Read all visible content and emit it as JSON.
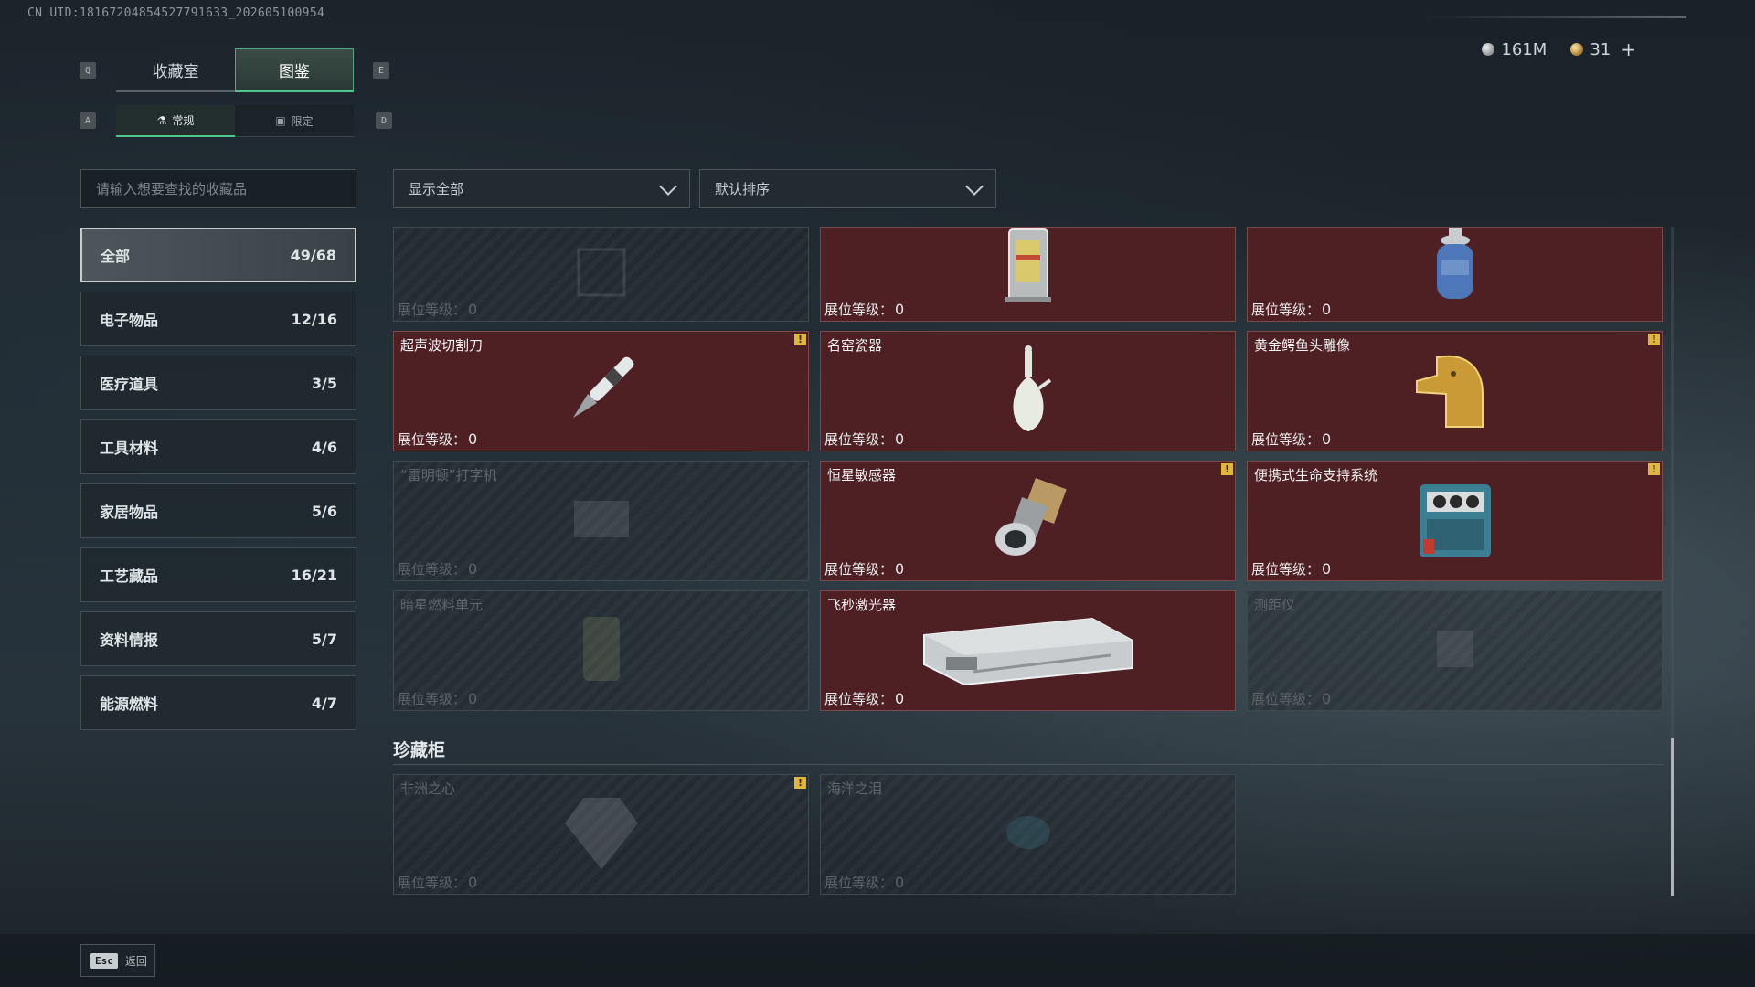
{
  "uid": "CN UID:18167204854527791633_202605100954",
  "currency": {
    "silver": "161M",
    "gold": "31",
    "plus": "+"
  },
  "keys": {
    "prev_tab": "Q",
    "next_tab": "E",
    "prev_sub": "A",
    "next_sub": "D"
  },
  "main_tabs": [
    {
      "label": "收藏室",
      "active": false
    },
    {
      "label": "图鉴",
      "active": true
    }
  ],
  "sub_tabs": [
    {
      "label": "常规",
      "icon": "flask-icon",
      "active": true
    },
    {
      "label": "限定",
      "icon": "image-icon",
      "active": false
    }
  ],
  "search": {
    "placeholder": "请输入想要查找的收藏品"
  },
  "categories": [
    {
      "label": "全部",
      "count": "49/68",
      "active": true
    },
    {
      "label": "电子物品",
      "count": "12/16"
    },
    {
      "label": "医疗道具",
      "count": "3/5"
    },
    {
      "label": "工具材料",
      "count": "4/6"
    },
    {
      "label": "家居物品",
      "count": "5/6"
    },
    {
      "label": "工艺藏品",
      "count": "16/21"
    },
    {
      "label": "资料情报",
      "count": "5/7"
    },
    {
      "label": "能源燃料",
      "count": "4/7"
    }
  ],
  "filters": {
    "show": "显示全部",
    "sort": "默认排序"
  },
  "level_label": "展位等级：",
  "items": [
    {
      "name": "",
      "level": "0",
      "owned": false,
      "alert": false,
      "icon": "unknown-item-icon"
    },
    {
      "name": "",
      "level": "0",
      "owned": true,
      "alert": false,
      "icon": "lantern-icon"
    },
    {
      "name": "",
      "level": "0",
      "owned": true,
      "alert": false,
      "icon": "gas-canister-icon"
    },
    {
      "name": "超声波切割刀",
      "level": "0",
      "owned": true,
      "alert": true,
      "icon": "cutter-knife-icon"
    },
    {
      "name": "名窑瓷器",
      "level": "0",
      "owned": true,
      "alert": false,
      "icon": "porcelain-vase-icon"
    },
    {
      "name": "黄金鳄鱼头雕像",
      "level": "0",
      "owned": true,
      "alert": true,
      "icon": "gold-crocodile-icon"
    },
    {
      "name": "“雷明顿”打字机",
      "level": "0",
      "owned": false,
      "alert": false,
      "icon": "typewriter-icon"
    },
    {
      "name": "恒星敏感器",
      "level": "0",
      "owned": true,
      "alert": true,
      "icon": "star-sensor-icon"
    },
    {
      "name": "便携式生命支持系统",
      "level": "0",
      "owned": true,
      "alert": true,
      "icon": "life-support-icon"
    },
    {
      "name": "暗星燃料单元",
      "level": "0",
      "owned": false,
      "alert": false,
      "icon": "fuel-cell-icon"
    },
    {
      "name": "飞秒激光器",
      "level": "0",
      "owned": true,
      "alert": false,
      "icon": "laser-device-icon"
    },
    {
      "name": "测距仪",
      "level": "0",
      "owned": false,
      "alert": false,
      "icon": "rangefinder-icon"
    }
  ],
  "section_title": "珍藏柜",
  "treasures": [
    {
      "name": "非洲之心",
      "level": "0",
      "owned": false,
      "alert": true,
      "icon": "gem-heart-icon"
    },
    {
      "name": "海洋之泪",
      "level": "0",
      "owned": false,
      "alert": false,
      "icon": "gem-tear-icon"
    }
  ],
  "footer": {
    "esc": "Esc",
    "back": "返回"
  }
}
